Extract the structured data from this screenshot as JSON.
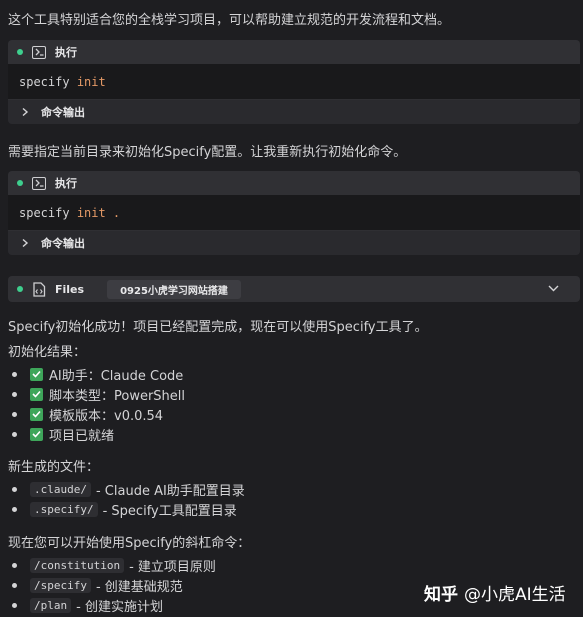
{
  "intro_text": "这个工具特别适合您的全栈学习项目，可以帮助建立规范的开发流程和文档。",
  "blocks": [
    {
      "header": "执行",
      "command": "specify",
      "command_args": "init",
      "footer": "命令输出"
    },
    {
      "header": "执行",
      "command": "specify",
      "command_args": "init .",
      "footer": "命令输出"
    }
  ],
  "between_text": "需要指定当前目录来初始化Specify配置。让我重新执行初始化命令。",
  "files": {
    "label": "Files",
    "tag": "0925小虎学习网站搭建"
  },
  "success_text": "Specify初始化成功！项目已经配置完成，现在可以使用Specify工具了。",
  "results_heading": "初始化结果：",
  "results": [
    "AI助手：Claude Code",
    "脚本类型：PowerShell",
    "模板版本：v0.0.54",
    "项目已就绪"
  ],
  "new_files_heading": "新生成的文件：",
  "new_files": [
    {
      "code": ".claude/",
      "desc": "- Claude AI助手配置目录"
    },
    {
      "code": ".specify/",
      "desc": "- Specify工具配置目录"
    }
  ],
  "commands_heading": "现在您可以开始使用Specify的斜杠命令：",
  "commands": [
    {
      "code": "/constitution",
      "desc": "- 建立项目原则"
    },
    {
      "code": "/specify",
      "desc": "- 创建基础规范"
    },
    {
      "code": "/plan",
      "desc": "- 创建实施计划"
    }
  ],
  "watermark": {
    "logo": "知乎",
    "handle": "@小虎AI生活"
  },
  "colors": {
    "accent_dot": "#3ecf8e",
    "check": "#3ea65a",
    "arg": "#e59a67"
  },
  "icons": [
    "terminal-icon",
    "chevron-right-icon",
    "file-code-icon",
    "chevron-down-icon",
    "checkbox-checked-icon"
  ]
}
